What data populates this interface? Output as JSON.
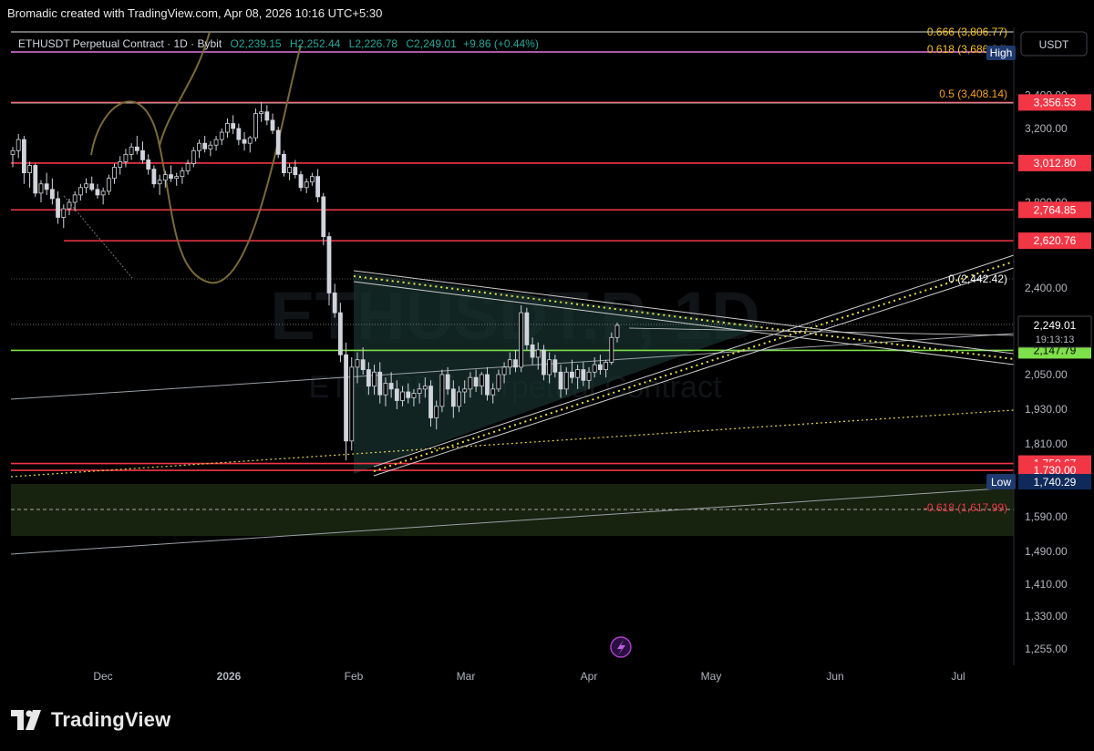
{
  "header": {
    "attribution": "Bromadic created with TradingView.com, Apr 08, 2026 10:16 UTC+5:30"
  },
  "legend": {
    "symbol": "ETHUSDT Perpetual Contract · 1D · Bybit",
    "open": "O2,239.15",
    "high": "H2,252.44",
    "low": "L2,226.78",
    "close": "C2,249.01",
    "change": "+9.86 (+0.44%)"
  },
  "currency_button": "USDT",
  "watermark": {
    "line1": "ETHUSDT.P, 1D",
    "line2": "ETHUSDT Perpetual Contract"
  },
  "footer": {
    "brand": "TradingView"
  },
  "colors": {
    "background": "#000000",
    "candle": "#d1d4dc",
    "resistance": "#f23645",
    "support": "#7ee04a",
    "fib": "#f7a21b",
    "triangle_fill": "#17302e",
    "zone_fill": "#17220f"
  },
  "chart_data": {
    "type": "candlestick",
    "symbol": "ETHUSDT.P",
    "timeframe": "1D",
    "ylim": [
      1255,
      3806.77
    ],
    "y_ticks": [
      1255,
      1330,
      1410,
      1490,
      1590,
      1810,
      1930,
      2050,
      2400,
      2800,
      3200,
      3400
    ],
    "y_tick_labels": [
      "1,255.00",
      "1,330.00",
      "1,410.00",
      "1,490.00",
      "1,590.00",
      "1,810.00",
      "1,930.00",
      "2,050.00",
      "2,400.00",
      "2,800.00",
      "3,200.00",
      "3,400.00"
    ],
    "x_labels": [
      "Dec",
      "2026",
      "Feb",
      "Mar",
      "Apr",
      "May",
      "Jun",
      "Jul"
    ],
    "last_price": 2249.01,
    "last_price_label": "2,249.01",
    "countdown": "19:13:13",
    "horizontal_levels": [
      {
        "price": 3356.53,
        "label": "3,356.53",
        "color": "#f23645"
      },
      {
        "price": 3012.8,
        "label": "3,012.80",
        "color": "#f23645"
      },
      {
        "price": 2764.85,
        "label": "2,764.85",
        "color": "#f23645"
      },
      {
        "price": 2620.76,
        "label": "2,620.76",
        "color": "#f23645"
      },
      {
        "price": 2147.79,
        "label": "2,147.79",
        "color": "#7ee04a"
      },
      {
        "price": 1750.67,
        "label": "1,750.67",
        "color": "#f23645"
      },
      {
        "price": 1730.0,
        "label": "1,730.00",
        "color": "#f23645"
      }
    ],
    "fib_levels": [
      {
        "label": "0.666 (3,806.77)",
        "price": 3806.77,
        "color": "#f7c21b"
      },
      {
        "label": "0.618 (3,686.04)",
        "price": 3686.04,
        "color": "#f7c21b"
      },
      {
        "label": "0.5 (3,408.14)",
        "price": 3408.14,
        "color": "#f7a21b"
      },
      {
        "label": "0 (2,442.42)",
        "price": 2442.42,
        "color": "#ffffff"
      },
      {
        "label": "-0.618 (1,617.99)",
        "price": 1617.99,
        "color": "#f23645"
      }
    ],
    "high_marker": "High",
    "low_marker": {
      "label": "Low",
      "price": 1740.29,
      "value_label": "1,740.29"
    },
    "candles_ohlc": [
      [
        3060,
        3100,
        2990,
        3080
      ],
      [
        3080,
        3170,
        3040,
        3140
      ],
      [
        3140,
        3160,
        2900,
        2960
      ],
      [
        2960,
        3020,
        2880,
        3000
      ],
      [
        3000,
        3010,
        2830,
        2850
      ],
      [
        2850,
        2920,
        2800,
        2900
      ],
      [
        2900,
        2960,
        2840,
        2870
      ],
      [
        2870,
        2930,
        2790,
        2820
      ],
      [
        2820,
        2860,
        2700,
        2730
      ],
      [
        2730,
        2790,
        2680,
        2770
      ],
      [
        2770,
        2820,
        2740,
        2800
      ],
      [
        2800,
        2860,
        2760,
        2840
      ],
      [
        2840,
        2900,
        2810,
        2880
      ],
      [
        2880,
        2930,
        2850,
        2900
      ],
      [
        2900,
        2940,
        2860,
        2870
      ],
      [
        2870,
        2900,
        2820,
        2840
      ],
      [
        2840,
        2880,
        2790,
        2860
      ],
      [
        2860,
        2950,
        2840,
        2930
      ],
      [
        2930,
        3010,
        2900,
        2990
      ],
      [
        2990,
        3050,
        2950,
        3020
      ],
      [
        3020,
        3090,
        2990,
        3060
      ],
      [
        3060,
        3120,
        3030,
        3100
      ],
      [
        3100,
        3160,
        3060,
        3080
      ],
      [
        3080,
        3130,
        3010,
        3030
      ],
      [
        3030,
        3060,
        2950,
        2980
      ],
      [
        2980,
        3000,
        2880,
        2900
      ],
      [
        2900,
        2950,
        2840,
        2920
      ],
      [
        2920,
        2970,
        2880,
        2950
      ],
      [
        2950,
        3000,
        2910,
        2930
      ],
      [
        2930,
        2960,
        2890,
        2940
      ],
      [
        2940,
        2990,
        2900,
        2970
      ],
      [
        2970,
        3030,
        2950,
        3010
      ],
      [
        3010,
        3100,
        2990,
        3080
      ],
      [
        3080,
        3140,
        3040,
        3120
      ],
      [
        3120,
        3160,
        3070,
        3090
      ],
      [
        3090,
        3130,
        3050,
        3110
      ],
      [
        3110,
        3160,
        3080,
        3140
      ],
      [
        3140,
        3200,
        3110,
        3180
      ],
      [
        3180,
        3260,
        3150,
        3230
      ],
      [
        3230,
        3280,
        3170,
        3200
      ],
      [
        3200,
        3230,
        3110,
        3140
      ],
      [
        3140,
        3180,
        3080,
        3120
      ],
      [
        3120,
        3160,
        3070,
        3150
      ],
      [
        3150,
        3320,
        3130,
        3290
      ],
      [
        3290,
        3360,
        3240,
        3300
      ],
      [
        3300,
        3340,
        3220,
        3250
      ],
      [
        3250,
        3290,
        3170,
        3190
      ],
      [
        3190,
        3210,
        3040,
        3060
      ],
      [
        3060,
        3080,
        2940,
        2960
      ],
      [
        2960,
        3010,
        2920,
        2990
      ],
      [
        2990,
        3030,
        2930,
        2950
      ],
      [
        2950,
        2970,
        2860,
        2880
      ],
      [
        2880,
        2930,
        2850,
        2910
      ],
      [
        2910,
        2960,
        2890,
        2940
      ],
      [
        2940,
        2980,
        2800,
        2830
      ],
      [
        2830,
        2850,
        2600,
        2640
      ],
      [
        2640,
        2660,
        2330,
        2380
      ],
      [
        2380,
        2420,
        2280,
        2300
      ],
      [
        2300,
        2340,
        2100,
        2130
      ],
      [
        2130,
        2180,
        1760,
        1820
      ],
      [
        1820,
        2120,
        1790,
        2080
      ],
      [
        2080,
        2140,
        2020,
        2110
      ],
      [
        2110,
        2160,
        2050,
        2070
      ],
      [
        2070,
        2100,
        1980,
        2010
      ],
      [
        2010,
        2090,
        1980,
        2060
      ],
      [
        2060,
        2100,
        1950,
        1980
      ],
      [
        1980,
        2040,
        1940,
        2020
      ],
      [
        2020,
        2060,
        1970,
        2000
      ],
      [
        2000,
        2030,
        1930,
        1960
      ],
      [
        1960,
        2010,
        1940,
        1990
      ],
      [
        1990,
        2020,
        1950,
        1970
      ],
      [
        1970,
        2000,
        1940,
        1985
      ],
      [
        1985,
        2020,
        1950,
        2000
      ],
      [
        2000,
        2040,
        1970,
        2010
      ],
      [
        2010,
        2030,
        1870,
        1900
      ],
      [
        1900,
        1960,
        1860,
        1940
      ],
      [
        1940,
        2070,
        1920,
        2050
      ],
      [
        2050,
        2080,
        1980,
        2000
      ],
      [
        2000,
        2030,
        1900,
        1940
      ],
      [
        1940,
        2010,
        1920,
        1990
      ],
      [
        1990,
        2030,
        1950,
        2000
      ],
      [
        2000,
        2060,
        1970,
        2040
      ],
      [
        2040,
        2070,
        1990,
        2010
      ],
      [
        2010,
        2060,
        1980,
        2050
      ],
      [
        2050,
        2080,
        1960,
        1980
      ],
      [
        1980,
        2020,
        1950,
        2000
      ],
      [
        2000,
        2070,
        1990,
        2050
      ],
      [
        2050,
        2100,
        2020,
        2080
      ],
      [
        2080,
        2140,
        2050,
        2110
      ],
      [
        2110,
        2150,
        2060,
        2080
      ],
      [
        2080,
        2330,
        2060,
        2300
      ],
      [
        2300,
        2320,
        2150,
        2170
      ],
      [
        2170,
        2200,
        2090,
        2120
      ],
      [
        2120,
        2180,
        2070,
        2150
      ],
      [
        2150,
        2170,
        2030,
        2050
      ],
      [
        2050,
        2140,
        2020,
        2110
      ],
      [
        2110,
        2130,
        2040,
        2060
      ],
      [
        2060,
        2090,
        1970,
        2000
      ],
      [
        2000,
        2080,
        1980,
        2060
      ],
      [
        2060,
        2110,
        2020,
        2040
      ],
      [
        2040,
        2090,
        2000,
        2070
      ],
      [
        2070,
        2100,
        2010,
        2030
      ],
      [
        2030,
        2080,
        2000,
        2060
      ],
      [
        2060,
        2120,
        2040,
        2090
      ],
      [
        2090,
        2130,
        2050,
        2070
      ],
      [
        2070,
        2110,
        2040,
        2100
      ],
      [
        2100,
        2220,
        2090,
        2200
      ],
      [
        2200,
        2260,
        2180,
        2249
      ]
    ]
  }
}
